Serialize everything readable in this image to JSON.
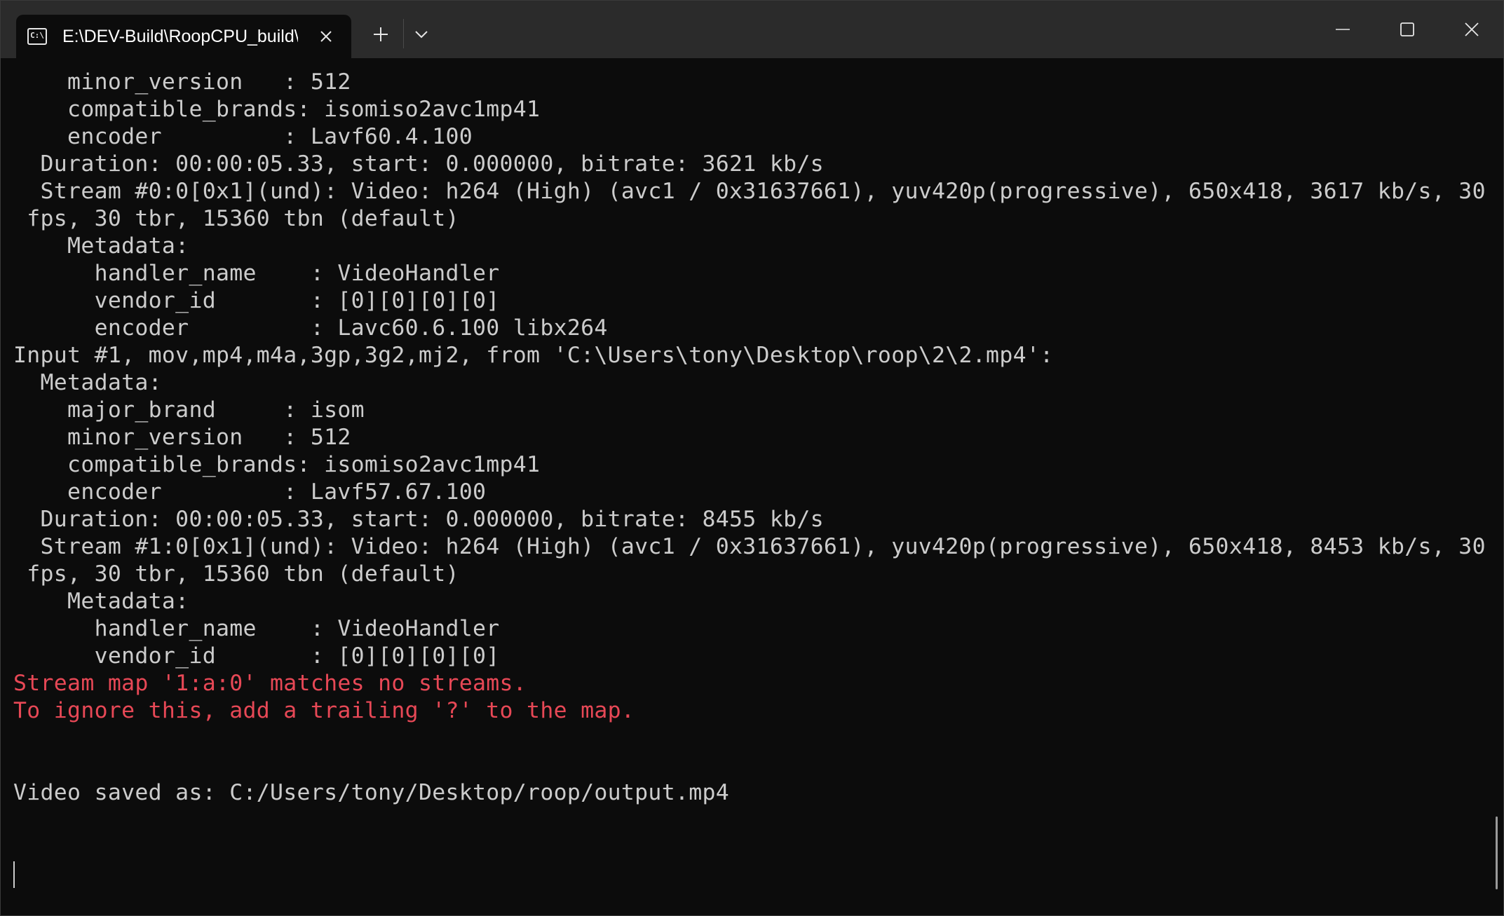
{
  "window": {
    "tab_title": "E:\\DEV-Build\\RoopCPU_build\\",
    "tab_icon": "console-icon",
    "icons": {
      "tab_close": "close-icon",
      "new_tab": "plus-icon",
      "dropdown": "chevron-down-icon",
      "minimize": "minimize-icon",
      "maximize": "maximize-icon",
      "close": "close-icon"
    }
  },
  "console": {
    "lines": [
      {
        "text": "    minor_version   : 512",
        "type": "normal"
      },
      {
        "text": "    compatible_brands: isomiso2avc1mp41",
        "type": "normal"
      },
      {
        "text": "    encoder         : Lavf60.4.100",
        "type": "normal"
      },
      {
        "text": "  Duration: 00:00:05.33, start: 0.000000, bitrate: 3621 kb/s",
        "type": "normal"
      },
      {
        "text": "  Stream #0:0[0x1](und): Video: h264 (High) (avc1 / 0x31637661), yuv420p(progressive), 650x418, 3617 kb/s, 30",
        "type": "normal"
      },
      {
        "text": " fps, 30 tbr, 15360 tbn (default)",
        "type": "normal"
      },
      {
        "text": "    Metadata:",
        "type": "normal"
      },
      {
        "text": "      handler_name    : VideoHandler",
        "type": "normal"
      },
      {
        "text": "      vendor_id       : [0][0][0][0]",
        "type": "normal"
      },
      {
        "text": "      encoder         : Lavc60.6.100 libx264",
        "type": "normal"
      },
      {
        "text": "Input #1, mov,mp4,m4a,3gp,3g2,mj2, from 'C:\\Users\\tony\\Desktop\\roop\\2\\2.mp4':",
        "type": "normal"
      },
      {
        "text": "  Metadata:",
        "type": "normal"
      },
      {
        "text": "    major_brand     : isom",
        "type": "normal"
      },
      {
        "text": "    minor_version   : 512",
        "type": "normal"
      },
      {
        "text": "    compatible_brands: isomiso2avc1mp41",
        "type": "normal"
      },
      {
        "text": "    encoder         : Lavf57.67.100",
        "type": "normal"
      },
      {
        "text": "  Duration: 00:00:05.33, start: 0.000000, bitrate: 8455 kb/s",
        "type": "normal"
      },
      {
        "text": "  Stream #1:0[0x1](und): Video: h264 (High) (avc1 / 0x31637661), yuv420p(progressive), 650x418, 8453 kb/s, 30",
        "type": "normal"
      },
      {
        "text": " fps, 30 tbr, 15360 tbn (default)",
        "type": "normal"
      },
      {
        "text": "    Metadata:",
        "type": "normal"
      },
      {
        "text": "      handler_name    : VideoHandler",
        "type": "normal"
      },
      {
        "text": "      vendor_id       : [0][0][0][0]",
        "type": "normal"
      },
      {
        "text": "Stream map '1:a:0' matches no streams.",
        "type": "error"
      },
      {
        "text": "To ignore this, add a trailing '?' to the map.",
        "type": "error"
      },
      {
        "text": "",
        "type": "normal"
      },
      {
        "text": "",
        "type": "normal"
      },
      {
        "text": "Video saved as: C:/Users/tony/Desktop/roop/output.mp4",
        "type": "normal"
      }
    ]
  }
}
